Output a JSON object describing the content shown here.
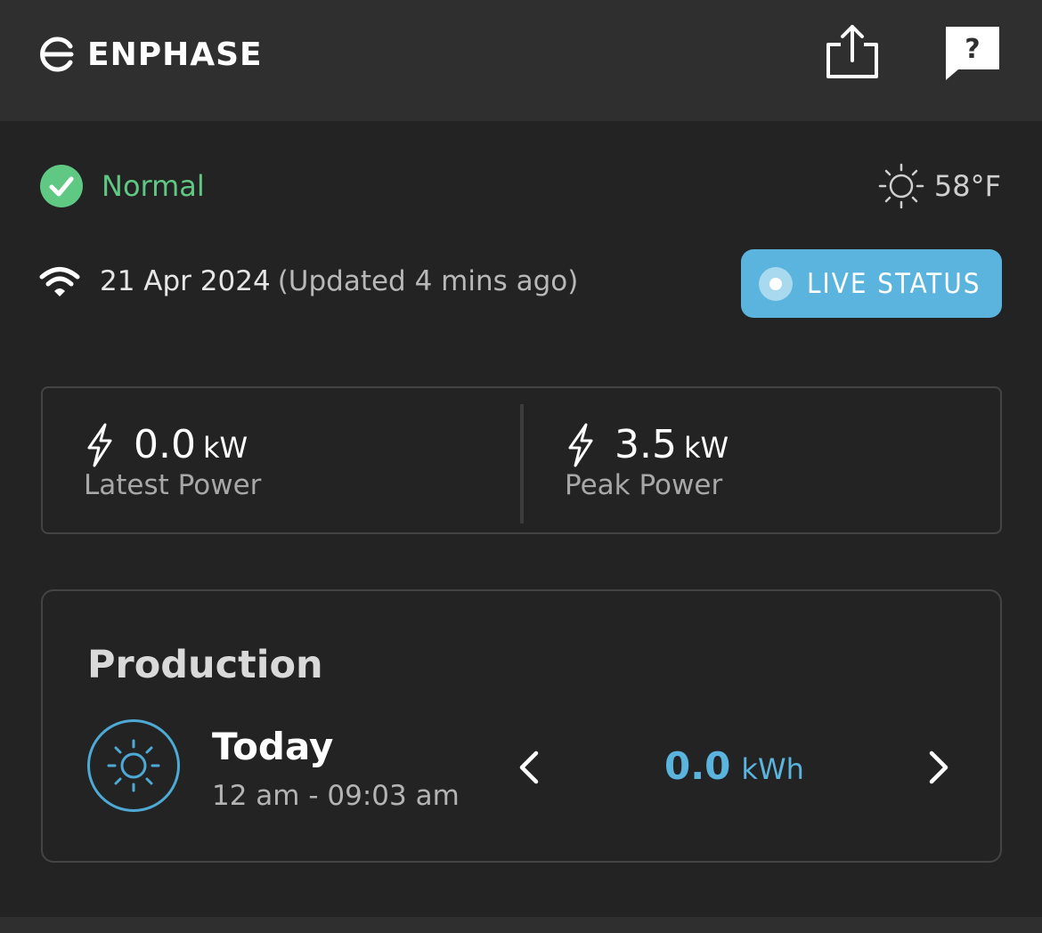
{
  "header": {
    "brand": "ENPHASE",
    "share_icon": "share-icon",
    "help_icon": "help-chat-icon"
  },
  "status": {
    "icon": "check-circle-icon",
    "label": "Normal",
    "color": "#5fc882"
  },
  "weather": {
    "icon": "sun-icon",
    "temperature": "58°F"
  },
  "update": {
    "icon": "wifi-icon",
    "date": "21 Apr 2024",
    "note": "(Updated 4 mins ago)"
  },
  "live_status": {
    "label": "LIVE STATUS",
    "color": "#5ab4de"
  },
  "power": {
    "latest": {
      "icon": "lightning-bolt-icon",
      "value": "0.0",
      "unit": "kW",
      "label": "Latest Power"
    },
    "peak": {
      "icon": "lightning-bolt-icon",
      "value": "3.5",
      "unit": "kW",
      "label": "Peak Power"
    }
  },
  "production": {
    "title": "Production",
    "period_icon": "sun-icon",
    "period": "Today",
    "range": "12 am - 09:03 am",
    "value": "0.0",
    "unit": "kWh",
    "prev_icon": "chevron-left-icon",
    "next_icon": "chevron-right-icon"
  }
}
